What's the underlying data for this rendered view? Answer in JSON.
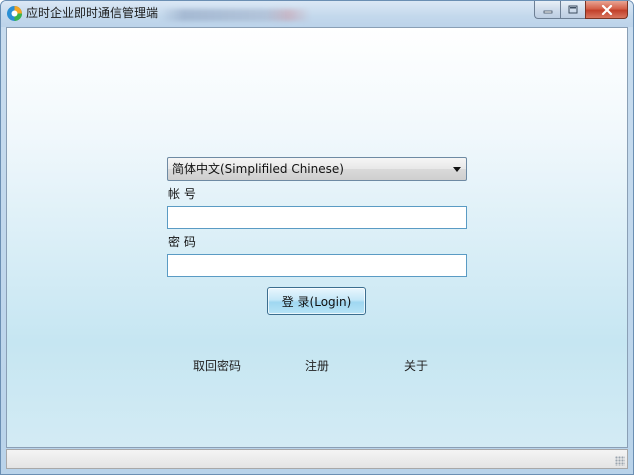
{
  "window": {
    "title": "应时企业即时通信管理端",
    "app_icon": "app-logo-icon",
    "controls": {
      "minimize_icon": "minimize-icon",
      "maximize_icon": "maximize-icon",
      "close_icon": "close-icon"
    }
  },
  "login": {
    "language": {
      "selected": "简体中文(Simplifiled Chinese)",
      "icon": "chevron-down-icon"
    },
    "account_label": "帐 号",
    "account_value": "",
    "password_label": "密 码",
    "password_value": "",
    "login_button": "登 录(Login)"
  },
  "links": {
    "retrieve_password": "取回密码",
    "register": "注册",
    "about": "关于"
  },
  "colors": {
    "accent_border": "#5a9bc4",
    "button_gradient_mid": "#9fd7f1",
    "close_red": "#c2402a"
  }
}
